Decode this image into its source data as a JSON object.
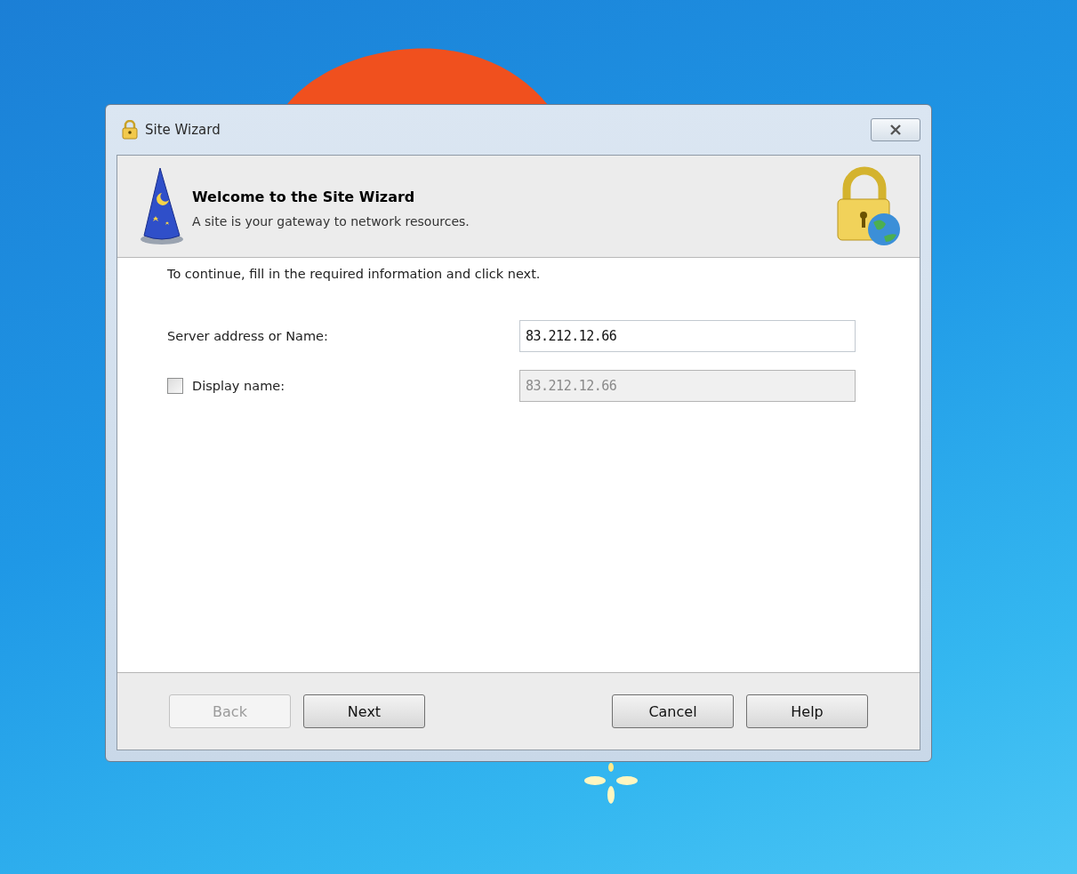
{
  "window": {
    "title": "Site Wizard"
  },
  "header": {
    "title": "Welcome to the Site Wizard",
    "subtitle": "A site is your gateway to network resources."
  },
  "instruction": "To continue, fill in the required information and click next.",
  "fields": [
    {
      "kind": "text",
      "label": "Server address or Name:",
      "value": "83.212.12.66",
      "disabled": false
    },
    {
      "kind": "checkbox",
      "label": "Display name:",
      "checked": false,
      "value": "83.212.12.66",
      "disabled": true
    }
  ],
  "buttons": [
    {
      "label": "Back",
      "disabled": true
    },
    {
      "label": "Next",
      "disabled": false
    },
    {
      "label": "Cancel",
      "disabled": false
    },
    {
      "label": "Help",
      "disabled": false
    }
  ]
}
